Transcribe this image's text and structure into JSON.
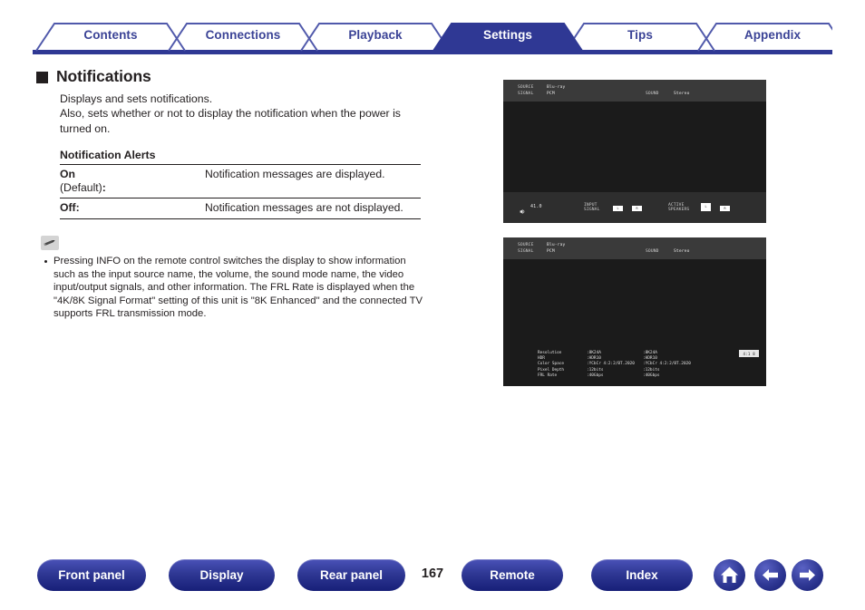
{
  "tabs": [
    {
      "label": "Contents",
      "active": false
    },
    {
      "label": "Connections",
      "active": false
    },
    {
      "label": "Playback",
      "active": false
    },
    {
      "label": "Settings",
      "active": true
    },
    {
      "label": "Tips",
      "active": false
    },
    {
      "label": "Appendix",
      "active": false
    }
  ],
  "heading": "Notifications",
  "intro": [
    "Displays and sets notifications.",
    "Also, sets whether or not to display the notification when the power is turned on."
  ],
  "subheading": "Notification Alerts",
  "options": [
    {
      "key": "On",
      "key_note": "(Default)",
      "key_colon": ":",
      "value": "Notification messages are displayed."
    },
    {
      "key": "Off",
      "key_note": "",
      "key_colon": ":",
      "value": "Notification messages are not displayed."
    }
  ],
  "note_icon": "pencil-icon",
  "notes": [
    "Pressing INFO on the remote control switches the display to show information such as the input source name, the volume, the sound mode name, the video input/output signals, and other information. The FRL Rate is displayed when the \"4K/8K Signal Format\" setting of this unit is \"8K Enhanced\" and the connected TV supports FRL transmission mode."
  ],
  "osd_screen_1": {
    "header": {
      "source_label": "SOURCE",
      "source_value": "Blu-ray",
      "signal_label": "SIGNAL",
      "signal_value": "PCM",
      "sound_label": "SOUND",
      "sound_value": "Stereo"
    },
    "footer": {
      "volume_icon": "speaker-icon",
      "volume_value": "41.0",
      "input_signal_label": "INPUT SIGNAL",
      "input_signal_chips": [
        "L",
        "R"
      ],
      "active_speakers_label": "ACTIVE SPEAKERS",
      "active_speaker_chips": [
        "L",
        "R"
      ]
    }
  },
  "osd_screen_2": {
    "header": {
      "source_label": "SOURCE",
      "source_value": "Blu-ray",
      "signal_label": "SIGNAL",
      "signal_value": "PCM",
      "sound_label": "SOUND",
      "sound_value": "Stereo"
    },
    "info_table": {
      "rows": [
        {
          "label": "Resolution",
          "input": ":8K24A",
          "output": ":8K24A"
        },
        {
          "label": "HDR",
          "input": ":HDR10",
          "output": ":HDR10"
        },
        {
          "label": "Color Space",
          "input": ":YCbCr 4:2:2/BT.2020",
          "output": ":YCbCr 4:2:2/BT.2020"
        },
        {
          "label": "Pixel Depth",
          "input": ":12bits",
          "output": ":12bits"
        },
        {
          "label": "FRL Rate",
          "input": ":40Gbps",
          "output": ":40Gbps"
        }
      ],
      "badge": "4:1 8"
    }
  },
  "footer": {
    "buttons": [
      {
        "label": "Front panel"
      },
      {
        "label": "Display"
      },
      {
        "label": "Rear panel"
      },
      {
        "label": "Remote"
      },
      {
        "label": "Index"
      }
    ],
    "page_number": "167",
    "icons": [
      {
        "name": "home-icon"
      },
      {
        "name": "arrow-left-icon"
      },
      {
        "name": "arrow-right-icon"
      }
    ]
  },
  "colors": {
    "brand": "#2f3894",
    "tab_text": "#3b4396",
    "ink": "#231f20"
  }
}
